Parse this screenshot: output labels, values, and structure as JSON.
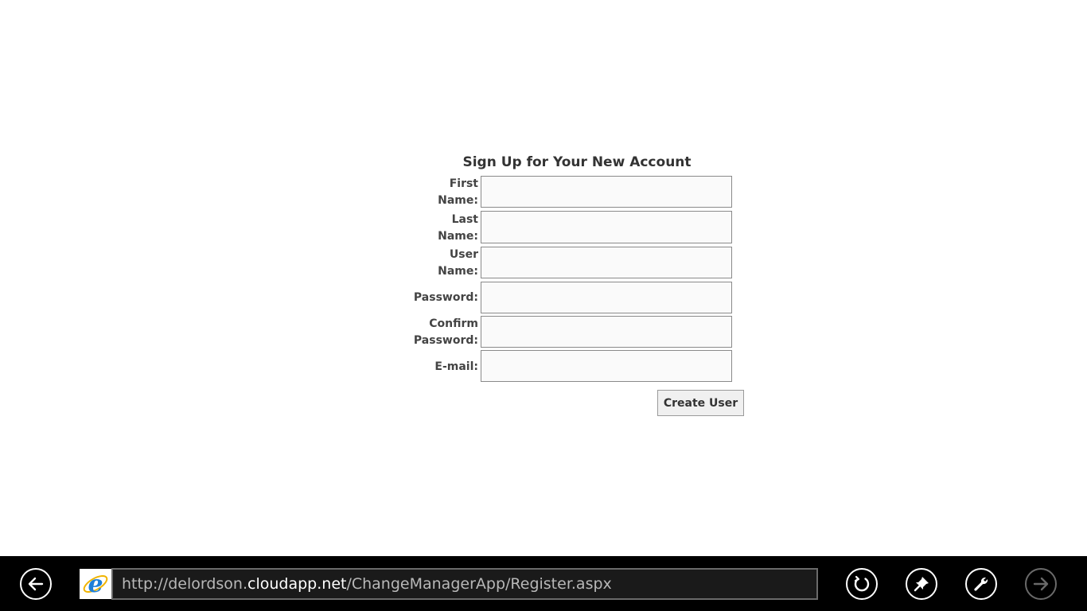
{
  "form": {
    "title": "Sign Up for Your New Account",
    "fields": [
      {
        "label_line1": "First",
        "label_line2": "Name:",
        "value": ""
      },
      {
        "label_line1": "Last",
        "label_line2": "Name:",
        "value": ""
      },
      {
        "label_line1": "User",
        "label_line2": "Name:",
        "value": ""
      },
      {
        "label_line1": "Password:",
        "label_line2": "",
        "value": ""
      },
      {
        "label_line1": "Confirm",
        "label_line2": "Password:",
        "value": ""
      },
      {
        "label_line1": "E-mail:",
        "label_line2": "",
        "value": ""
      }
    ],
    "submit_label": "Create User"
  },
  "browser": {
    "url_prefix": "http://delordson.",
    "url_domain": "cloudapp.net",
    "url_path": "/ChangeManagerApp/Register.aspx",
    "buttons": {
      "back": "back-arrow-icon",
      "refresh": "refresh-icon",
      "pin": "pin-icon",
      "tools": "wrench-icon",
      "forward": "forward-arrow-icon"
    },
    "colors": {
      "bar_background": "#000000",
      "ie_blue": "#1e7fd8"
    }
  }
}
